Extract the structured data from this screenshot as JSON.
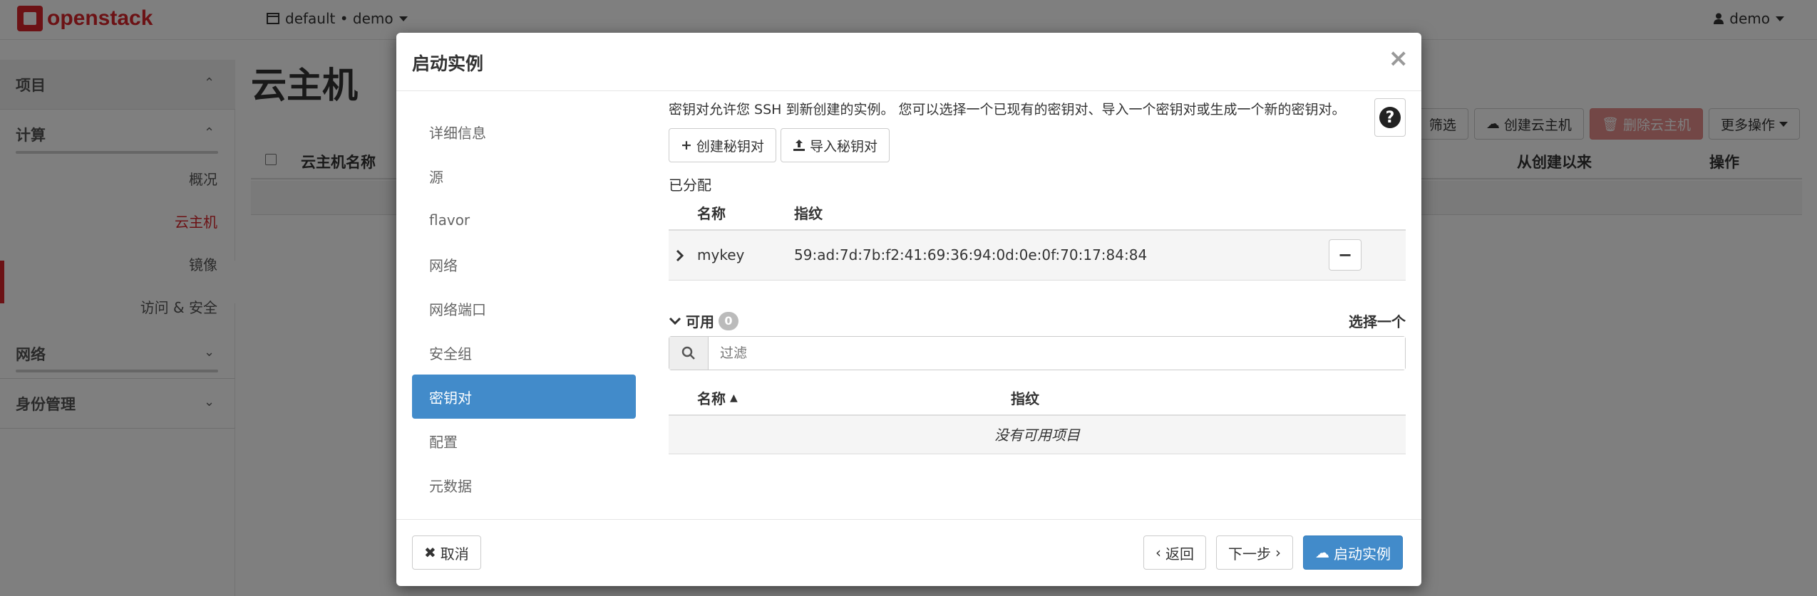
{
  "header": {
    "logo_text": "openstack",
    "project_selector": "default • demo",
    "user_menu": "demo"
  },
  "sidebar": {
    "groups": [
      {
        "label": "项目"
      },
      {
        "label": "计算"
      },
      {
        "label": "网络"
      },
      {
        "label": "身份管理"
      }
    ],
    "compute_items": [
      "概况",
      "云主机",
      "镜像",
      "访问 & 安全"
    ],
    "active_item": "云主机"
  },
  "page": {
    "title": "云主机",
    "toolbar": {
      "filter": "筛选",
      "create": "创建云主机",
      "delete": "删除云主机",
      "more": "更多操作"
    },
    "table_headers": {
      "name": "云主机名称",
      "since": "从创建以来",
      "actions": "操作"
    }
  },
  "modal": {
    "title": "启动实例",
    "close": "×",
    "nav": [
      "详细信息",
      "源",
      "flavor",
      "网络",
      "网络端口",
      "安全组",
      "密钥对",
      "配置",
      "元数据"
    ],
    "active_nav": "密钥对",
    "description": "密钥对允许您 SSH 到新创建的实例。 您可以选择一个已现有的密钥对、导入一个密钥对或生成一个新的密钥对。",
    "buttons": {
      "create_keypair": "创建秘钥对",
      "import_keypair": "导入秘钥对"
    },
    "allocated": {
      "label": "已分配",
      "headers": {
        "name": "名称",
        "fingerprint": "指纹"
      },
      "rows": [
        {
          "name": "mykey",
          "fingerprint": "59:ad:7d:7b:f2:41:69:36:94:0d:0e:0f:70:17:84:84"
        }
      ]
    },
    "available": {
      "label": "可用",
      "count": "0",
      "select_one": "选择一个",
      "filter_placeholder": "过滤",
      "headers": {
        "name": "名称",
        "fingerprint": "指纹"
      },
      "empty_text": "没有可用项目"
    },
    "footer": {
      "cancel": "取消",
      "back": "返回",
      "next": "下一步",
      "launch": "启动实例"
    }
  },
  "colors": {
    "primary": "#428bca",
    "brand_red": "#d9252b",
    "danger": "#d9534f"
  }
}
